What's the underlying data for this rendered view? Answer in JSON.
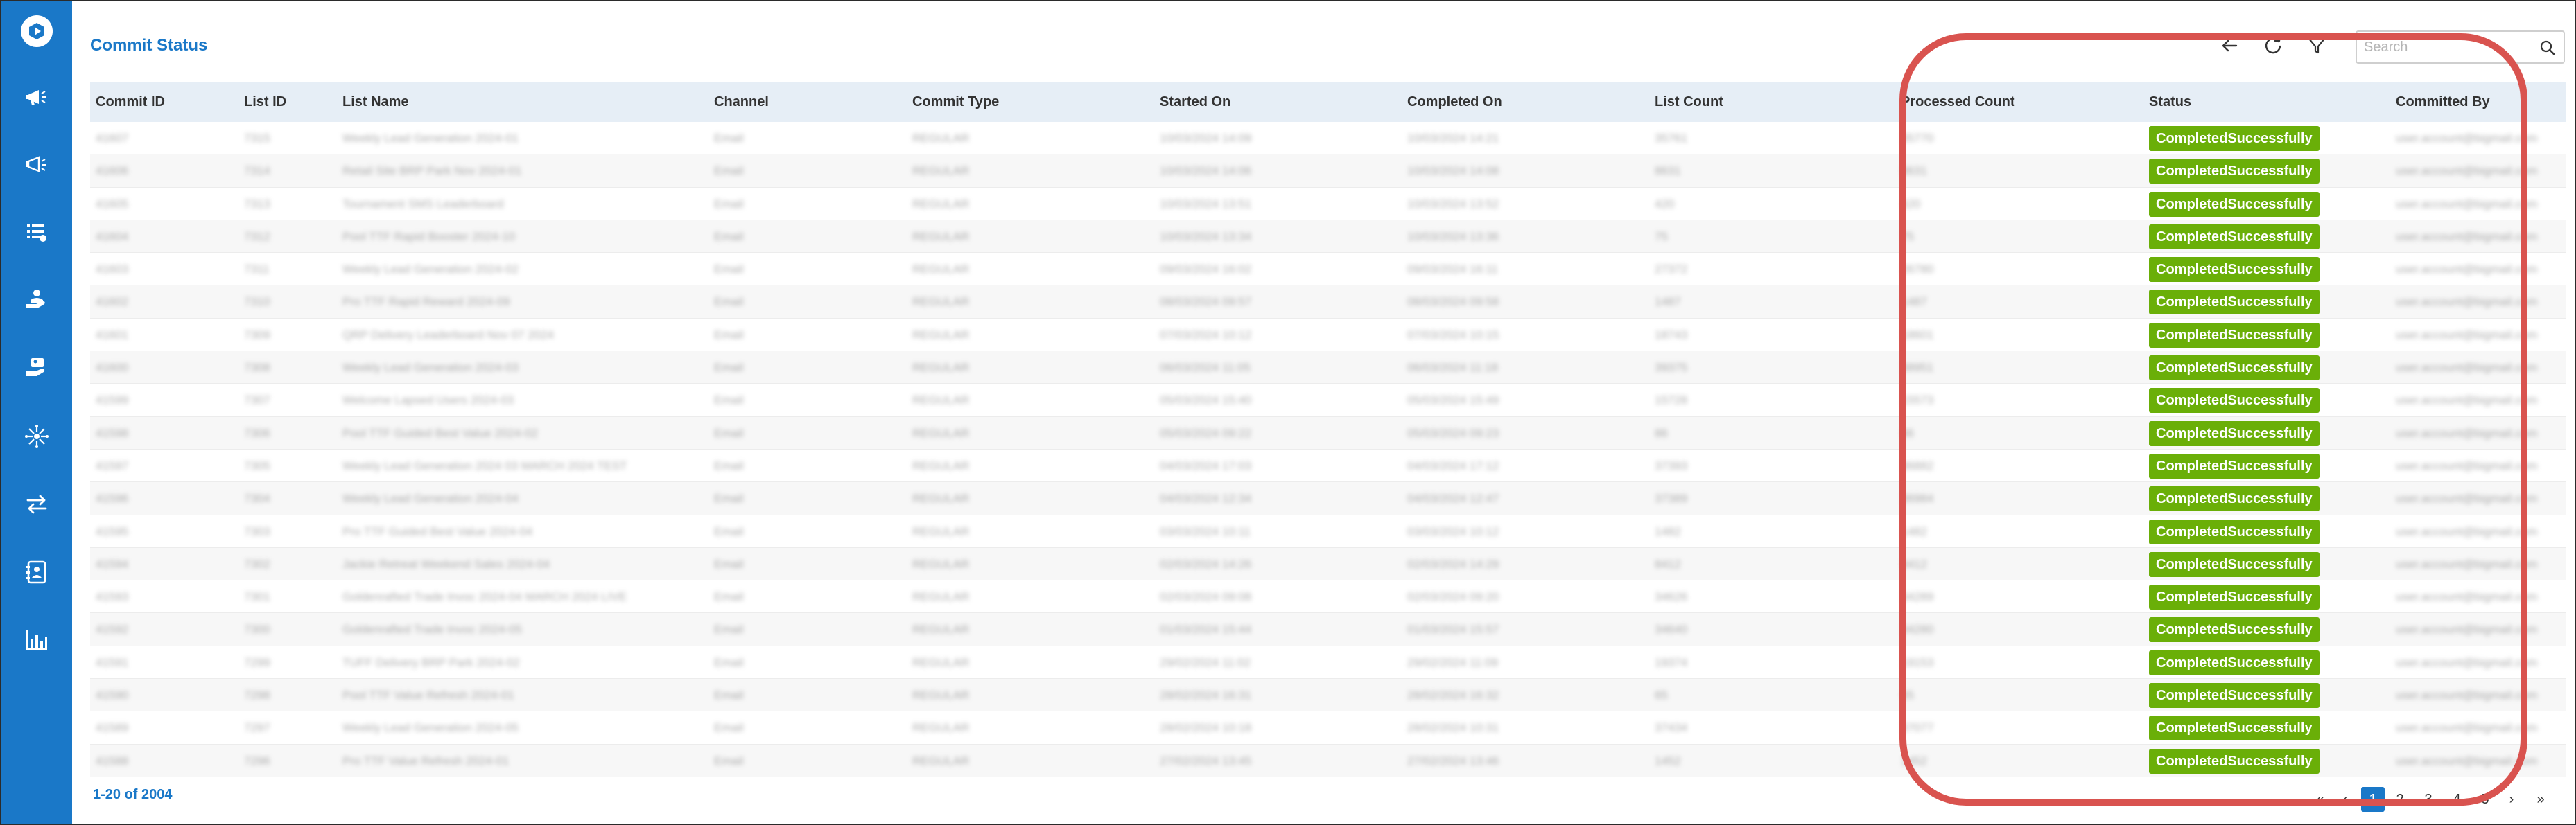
{
  "page": {
    "title": "Commit Status"
  },
  "sidebar": {
    "items": [
      {
        "name": "campaign-icon"
      },
      {
        "name": "broadcast-icon"
      },
      {
        "name": "list-icon"
      },
      {
        "name": "hand-user-icon"
      },
      {
        "name": "hand-card-icon"
      },
      {
        "name": "network-icon"
      },
      {
        "name": "transfer-icon"
      },
      {
        "name": "contact-card-icon"
      },
      {
        "name": "bar-chart-icon"
      }
    ]
  },
  "toolbar": {
    "search_placeholder": "Search"
  },
  "table": {
    "columns": [
      "Commit ID",
      "List ID",
      "List Name",
      "Channel",
      "Commit Type",
      "Started On",
      "Completed On",
      "List Count",
      "Processed Count",
      "Status",
      "Committed By"
    ],
    "rows": [
      {
        "commit_id": "41607",
        "list_id": "7315",
        "list_name": "Weekly Lead Generation 2024-01",
        "channel": "Email",
        "commit_type": "REGULAR",
        "started_on": "10/03/2024 14:09",
        "completed_on": "10/03/2024 14:21",
        "list_count": "35761",
        "processed_count": "35770",
        "status": "CompletedSuccessfully",
        "committed_by": "user.account@bigmail.com"
      },
      {
        "commit_id": "41606",
        "list_id": "7314",
        "list_name": "Retail Site BRP Park Nov 2024-01",
        "channel": "Email",
        "commit_type": "REGULAR",
        "started_on": "10/03/2024 14:06",
        "completed_on": "10/03/2024 14:08",
        "list_count": "8631",
        "processed_count": "8631",
        "status": "CompletedSuccessfully",
        "committed_by": "user.account@bigmail.com"
      },
      {
        "commit_id": "41605",
        "list_id": "7313",
        "list_name": "Tournament SMS Leaderboard",
        "channel": "Email",
        "commit_type": "REGULAR",
        "started_on": "10/03/2024 13:51",
        "completed_on": "10/03/2024 13:52",
        "list_count": "420",
        "processed_count": "420",
        "status": "CompletedSuccessfully",
        "committed_by": "user.account@bigmail.com"
      },
      {
        "commit_id": "41604",
        "list_id": "7312",
        "list_name": "Pool TTF Rapid Booster 2024-10",
        "channel": "Email",
        "commit_type": "REGULAR",
        "started_on": "10/03/2024 13:34",
        "completed_on": "10/03/2024 13:36",
        "list_count": "75",
        "processed_count": "75",
        "status": "CompletedSuccessfully",
        "committed_by": "user.account@bigmail.com"
      },
      {
        "commit_id": "41603",
        "list_id": "7311",
        "list_name": "Weekly Lead Generation 2024-02",
        "channel": "Email",
        "commit_type": "REGULAR",
        "started_on": "09/03/2024 16:02",
        "completed_on": "09/03/2024 16:11",
        "list_count": "27372",
        "processed_count": "26780",
        "status": "CompletedSuccessfully",
        "committed_by": "user.account@bigmail.com"
      },
      {
        "commit_id": "41602",
        "list_id": "7310",
        "list_name": "Pro TTF Rapid Reward 2024-09",
        "channel": "Email",
        "commit_type": "REGULAR",
        "started_on": "08/03/2024 09:57",
        "completed_on": "08/03/2024 09:58",
        "list_count": "1487",
        "processed_count": "1487",
        "status": "CompletedSuccessfully",
        "committed_by": "user.account@bigmail.com"
      },
      {
        "commit_id": "41601",
        "list_id": "7309",
        "list_name": "QRP Delivery Leaderboard Nov 07 2024",
        "channel": "Email",
        "commit_type": "REGULAR",
        "started_on": "07/03/2024 10:12",
        "completed_on": "07/03/2024 10:15",
        "list_count": "18743",
        "processed_count": "18601",
        "status": "CompletedSuccessfully",
        "committed_by": "user.account@bigmail.com"
      },
      {
        "commit_id": "41600",
        "list_id": "7308",
        "list_name": "Weekly Lead Generation 2024-03",
        "channel": "Email",
        "commit_type": "REGULAR",
        "started_on": "06/03/2024 11:05",
        "completed_on": "06/03/2024 11:18",
        "list_count": "39375",
        "processed_count": "38951",
        "status": "CompletedSuccessfully",
        "committed_by": "user.account@bigmail.com"
      },
      {
        "commit_id": "41599",
        "list_id": "7307",
        "list_name": "Welcome Lapsed Users 2024-03",
        "channel": "Email",
        "commit_type": "REGULAR",
        "started_on": "05/03/2024 15:40",
        "completed_on": "05/03/2024 15:49",
        "list_count": "15728",
        "processed_count": "15573",
        "status": "CompletedSuccessfully",
        "committed_by": "user.account@bigmail.com"
      },
      {
        "commit_id": "41598",
        "list_id": "7306",
        "list_name": "Pool TTF Guided Best Value 2024-02",
        "channel": "Email",
        "commit_type": "REGULAR",
        "started_on": "05/03/2024 09:22",
        "completed_on": "05/03/2024 09:23",
        "list_count": "86",
        "processed_count": "86",
        "status": "CompletedSuccessfully",
        "committed_by": "user.account@bigmail.com"
      },
      {
        "commit_id": "41597",
        "list_id": "7305",
        "list_name": "Weekly Lead Generation 2024 03 MARCH 2024 TEST",
        "channel": "Email",
        "commit_type": "REGULAR",
        "started_on": "04/03/2024 17:03",
        "completed_on": "04/03/2024 17:12",
        "list_count": "37393",
        "processed_count": "36882",
        "status": "CompletedSuccessfully",
        "committed_by": "user.account@bigmail.com"
      },
      {
        "commit_id": "41596",
        "list_id": "7304",
        "list_name": "Weekly Lead Generation 2024-04",
        "channel": "Email",
        "commit_type": "REGULAR",
        "started_on": "04/03/2024 12:34",
        "completed_on": "04/03/2024 12:47",
        "list_count": "37389",
        "processed_count": "36984",
        "status": "CompletedSuccessfully",
        "committed_by": "user.account@bigmail.com"
      },
      {
        "commit_id": "41595",
        "list_id": "7303",
        "list_name": "Pro TTF Guided Best Value 2024-04",
        "channel": "Email",
        "commit_type": "REGULAR",
        "started_on": "03/03/2024 10:11",
        "completed_on": "03/03/2024 10:12",
        "list_count": "1482",
        "processed_count": "1482",
        "status": "CompletedSuccessfully",
        "committed_by": "user.account@bigmail.com"
      },
      {
        "commit_id": "41594",
        "list_id": "7302",
        "list_name": "Jackie Retreat Weekend Sales 2024-04",
        "channel": "Email",
        "commit_type": "REGULAR",
        "started_on": "02/03/2024 14:26",
        "completed_on": "02/03/2024 14:29",
        "list_count": "8412",
        "processed_count": "8412",
        "status": "CompletedSuccessfully",
        "committed_by": "user.account@bigmail.com"
      },
      {
        "commit_id": "41593",
        "list_id": "7301",
        "list_name": "Goldenrafted Trade Invoc 2024-04 MARCH 2024 LIVE",
        "channel": "Email",
        "commit_type": "REGULAR",
        "started_on": "02/03/2024 09:08",
        "completed_on": "02/03/2024 09:20",
        "list_count": "34626",
        "processed_count": "34289",
        "status": "CompletedSuccessfully",
        "committed_by": "user.account@bigmail.com"
      },
      {
        "commit_id": "41592",
        "list_id": "7300",
        "list_name": "Goldenrafted Trade Invoc 2024-05",
        "channel": "Email",
        "commit_type": "REGULAR",
        "started_on": "01/03/2024 15:44",
        "completed_on": "01/03/2024 15:57",
        "list_count": "34640",
        "processed_count": "34280",
        "status": "CompletedSuccessfully",
        "committed_by": "user.account@bigmail.com"
      },
      {
        "commit_id": "41591",
        "list_id": "7299",
        "list_name": "TUFF Delivery BRP Park 2024-02",
        "channel": "Email",
        "commit_type": "REGULAR",
        "started_on": "29/02/2024 11:02",
        "completed_on": "29/02/2024 11:09",
        "list_count": "19374",
        "processed_count": "19153",
        "status": "CompletedSuccessfully",
        "committed_by": "user.account@bigmail.com"
      },
      {
        "commit_id": "41590",
        "list_id": "7298",
        "list_name": "Pool TTF Value Refresh 2024-01",
        "channel": "Email",
        "commit_type": "REGULAR",
        "started_on": "28/02/2024 16:31",
        "completed_on": "28/02/2024 16:32",
        "list_count": "65",
        "processed_count": "65",
        "status": "CompletedSuccessfully",
        "committed_by": "user.account@bigmail.com"
      },
      {
        "commit_id": "41589",
        "list_id": "7297",
        "list_name": "Weekly Lead Generation 2024-05",
        "channel": "Email",
        "commit_type": "REGULAR",
        "started_on": "28/02/2024 10:18",
        "completed_on": "28/02/2024 10:31",
        "list_count": "37434",
        "processed_count": "37077",
        "status": "CompletedSuccessfully",
        "committed_by": "user.account@bigmail.com"
      },
      {
        "commit_id": "41588",
        "list_id": "7296",
        "list_name": "Pro TTF Value Refresh 2024-01",
        "channel": "Email",
        "commit_type": "REGULAR",
        "started_on": "27/02/2024 13:45",
        "completed_on": "27/02/2024 13:46",
        "list_count": "1452",
        "processed_count": "1452",
        "status": "CompletedSuccessfully",
        "committed_by": "user.account@bigmail.com"
      }
    ]
  },
  "footer": {
    "count": "1-20 of 2004",
    "pages": [
      "1",
      "2",
      "3",
      "4",
      "5"
    ],
    "first": "«",
    "prev": "‹",
    "next": "›",
    "last": "»"
  },
  "colors": {
    "accent": "#1a78c8",
    "status_success": "#6aaf08",
    "annotation": "#d9534f"
  }
}
